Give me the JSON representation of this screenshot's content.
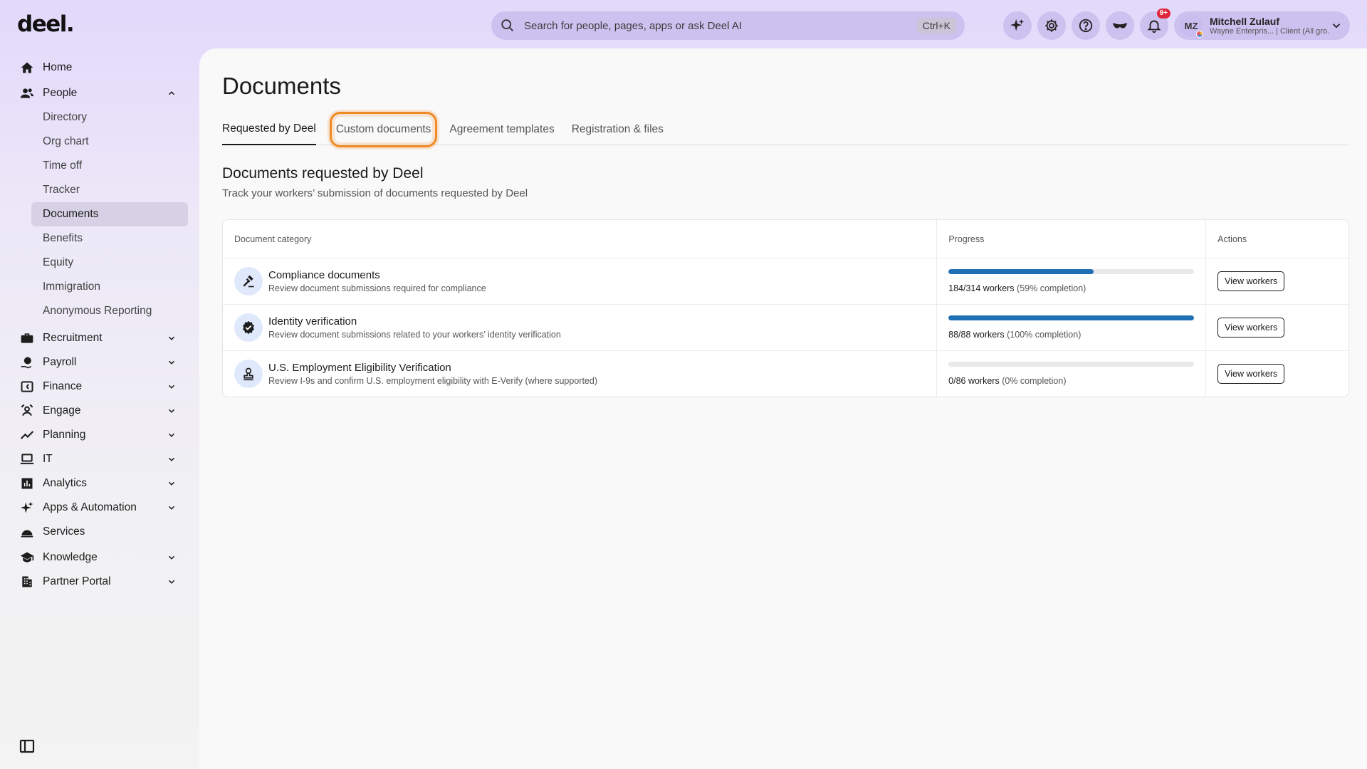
{
  "brand": {
    "logo": "deel."
  },
  "search": {
    "placeholder": "Search for people, pages, apps or ask Deel AI",
    "shortcut": "Ctrl+K"
  },
  "header": {
    "icons": [
      "sparkle-icon",
      "gear-icon",
      "help-icon",
      "mask-icon",
      "bell-icon"
    ],
    "notification_badge": "9+",
    "user": {
      "initials": "MZ",
      "name": "Mitchell Zulauf",
      "org": "Wayne Enterpris... | Client (All gro..."
    }
  },
  "sidebar": {
    "home": "Home",
    "people": "People",
    "people_sub": [
      "Directory",
      "Org chart",
      "Time off",
      "Tracker",
      "Documents",
      "Benefits",
      "Equity",
      "Immigration",
      "Anonymous Reporting"
    ],
    "active_sub": "Documents",
    "sections": [
      "Recruitment",
      "Payroll",
      "Finance",
      "Engage",
      "Planning",
      "IT",
      "Analytics",
      "Apps & Automation",
      "Services",
      "Knowledge",
      "Partner Portal"
    ]
  },
  "page": {
    "title": "Documents",
    "tabs": [
      "Requested by Deel",
      "Custom documents",
      "Agreement templates",
      "Registration & files"
    ],
    "active_tab": "Requested by Deel",
    "highlighted_tab": "Custom documents",
    "section_title": "Documents requested by Deel",
    "section_subtitle": "Track your workers’ submission of documents requested by Deel"
  },
  "table": {
    "headers": [
      "Document category",
      "Progress",
      "Actions"
    ],
    "rows": [
      {
        "name": "Compliance documents",
        "desc": "Review document submissions required for compliance",
        "count": "184/314 workers",
        "pct": "(59% completion)",
        "progress": 0.59,
        "action": "View workers",
        "icon": "gavel-icon"
      },
      {
        "name": "Identity verification",
        "desc": "Review document submissions related to your workers’ identity verification",
        "count": "88/88 workers",
        "pct": "(100% completion)",
        "progress": 1.0,
        "action": "View workers",
        "icon": "verified-badge-icon"
      },
      {
        "name": "U.S. Employment Eligibility Verification",
        "desc": "Review I-9s and confirm U.S. employment eligibility with E-Verify (where supported)",
        "count": "0/86 workers",
        "pct": "(0% completion)",
        "progress": 0.0,
        "action": "View workers",
        "icon": "stamp-icon"
      }
    ]
  },
  "colors": {
    "accent": "#1f6fb5",
    "highlight": "#f08a24",
    "active_nav": "#d6d1e4"
  }
}
